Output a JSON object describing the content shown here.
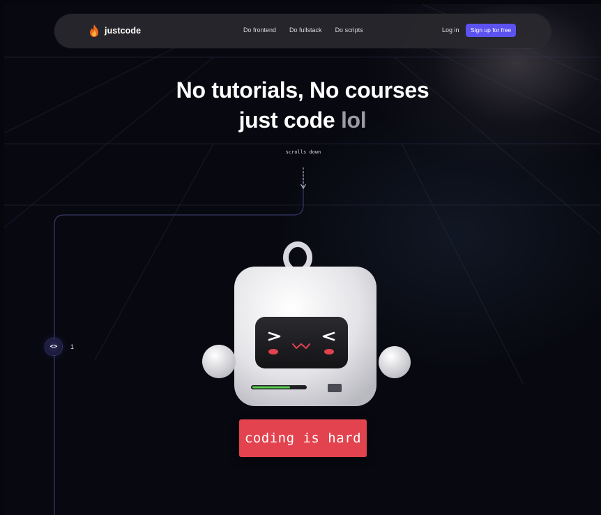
{
  "header": {
    "brand": "justcode",
    "brand_icon": "flame-icon",
    "nav_links": [
      "Do frontend",
      "Do fullstack",
      "Do scripts"
    ],
    "login_label": "Log in",
    "signup_label": "Sign up for free"
  },
  "hero": {
    "line1": "No tutorials,  No courses",
    "line2_main": "just code ",
    "line2_muted": "lol"
  },
  "scroll_hint": "scrolls down",
  "rail": {
    "icon": "code-brackets-icon",
    "step": "1"
  },
  "cta": {
    "label": "coding is hard"
  },
  "colors": {
    "background": "#080910",
    "nav_bg": "#28282e",
    "accent": "#5b52f0",
    "cta": "#e2434e",
    "muted_text": "#9b9ba4"
  }
}
